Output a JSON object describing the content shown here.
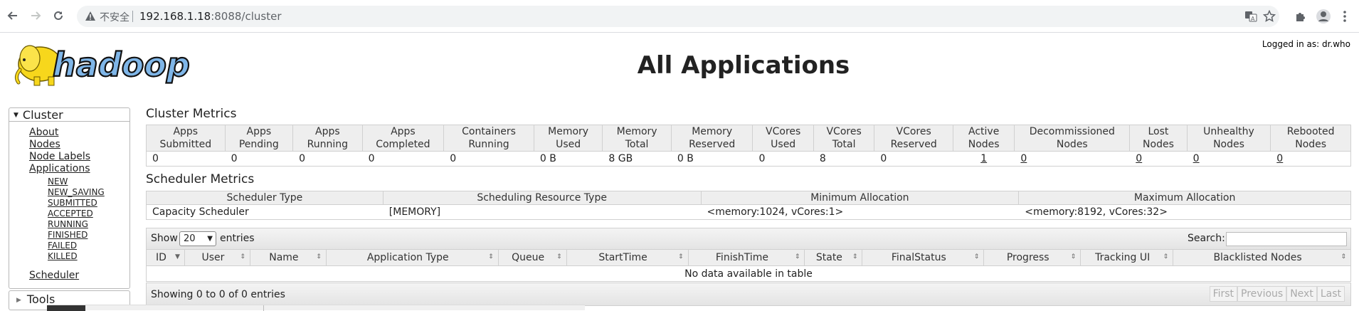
{
  "browser": {
    "insecure_label": "不安全",
    "url_host": "192.168.1.18",
    "url_rest": ":8088/cluster"
  },
  "header": {
    "logged_in": "Logged in as: dr.who",
    "title": "All Applications",
    "logo_text": "hadoop"
  },
  "nav": {
    "cluster_label": "Cluster",
    "links": [
      "About",
      "Nodes",
      "Node Labels",
      "Applications"
    ],
    "app_states": [
      "NEW",
      "NEW_SAVING",
      "SUBMITTED",
      "ACCEPTED",
      "RUNNING",
      "FINISHED",
      "FAILED",
      "KILLED"
    ],
    "scheduler_label": "Scheduler",
    "tools_label": "Tools"
  },
  "cluster_metrics": {
    "title": "Cluster Metrics",
    "headers": [
      [
        "Apps",
        "Submitted"
      ],
      [
        "Apps",
        "Pending"
      ],
      [
        "Apps",
        "Running"
      ],
      [
        "Apps",
        "Completed"
      ],
      [
        "Containers",
        "Running"
      ],
      [
        "Memory",
        "Used"
      ],
      [
        "Memory",
        "Total"
      ],
      [
        "Memory",
        "Reserved"
      ],
      [
        "VCores",
        "Used"
      ],
      [
        "VCores",
        "Total"
      ],
      [
        "VCores",
        "Reserved"
      ],
      [
        "Active",
        "Nodes"
      ],
      [
        "Decommissioned",
        "Nodes"
      ],
      [
        "Lost",
        "Nodes"
      ],
      [
        "Unhealthy",
        "Nodes"
      ],
      [
        "Rebooted",
        "Nodes"
      ]
    ],
    "values": [
      "0",
      "0",
      "0",
      "0",
      "0",
      "0 B",
      "8 GB",
      "0 B",
      "0",
      "8",
      "0",
      "1",
      "0",
      "0",
      "0",
      "0"
    ]
  },
  "scheduler_metrics": {
    "title": "Scheduler Metrics",
    "headers": [
      "Scheduler Type",
      "Scheduling Resource Type",
      "Minimum Allocation",
      "Maximum Allocation"
    ],
    "values": [
      "Capacity Scheduler",
      "[MEMORY]",
      "<memory:1024, vCores:1>",
      "<memory:8192, vCores:32>"
    ]
  },
  "apps_table": {
    "show_label": "Show",
    "page_size": "20",
    "entries_label": "entries",
    "search_label": "Search:",
    "columns": [
      "ID",
      "User",
      "Name",
      "Application Type",
      "Queue",
      "StartTime",
      "FinishTime",
      "State",
      "FinalStatus",
      "Progress",
      "Tracking UI",
      "Blacklisted Nodes"
    ],
    "empty_message": "No data available in table",
    "info": "Showing 0 to 0 of 0 entries",
    "pager": [
      "First",
      "Previous",
      "Next",
      "Last"
    ]
  }
}
